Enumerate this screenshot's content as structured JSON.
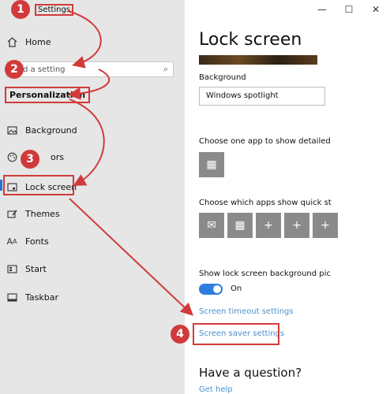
{
  "window": {
    "title": "Settings",
    "controls": {
      "minimize": "—",
      "maximize": "☐",
      "close": "✕"
    }
  },
  "sidebar": {
    "home": {
      "label": "Home",
      "icon": "home-icon"
    },
    "search": {
      "placeholder": "Find a setting",
      "visible_text": "d a setting"
    },
    "section": "Personalization",
    "items": [
      {
        "label": "Background",
        "icon": "picture-icon"
      },
      {
        "label": "Colors",
        "visible_text": "ors",
        "icon": "palette-icon"
      },
      {
        "label": "Lock screen",
        "icon": "lock-screen-icon",
        "active": true
      },
      {
        "label": "Themes",
        "icon": "brush-icon"
      },
      {
        "label": "Fonts",
        "icon": "font-icon"
      },
      {
        "label": "Start",
        "icon": "start-icon"
      },
      {
        "label": "Taskbar",
        "icon": "taskbar-icon"
      }
    ]
  },
  "main": {
    "title": "Lock screen",
    "background_label": "Background",
    "background_value": "Windows spotlight",
    "detailed_label": "Choose one app to show detailed",
    "quick_label": "Choose which apps show quick st",
    "show_bg_label": "Show lock screen background pic",
    "toggle": {
      "state": "On",
      "on": true
    },
    "timeout_link": "Screen timeout settings",
    "saver_link": "Screen saver settings",
    "question": "Have a question?",
    "help_link": "Get help"
  },
  "annotations": {
    "badges": [
      "1",
      "2",
      "3",
      "4"
    ],
    "color": "#d13a3a"
  },
  "colors": {
    "accent": "#2d7ee0",
    "link": "#4a8fd0",
    "sidebar_bg": "#e6e6e6",
    "tile_bg": "#8a8a8a"
  }
}
